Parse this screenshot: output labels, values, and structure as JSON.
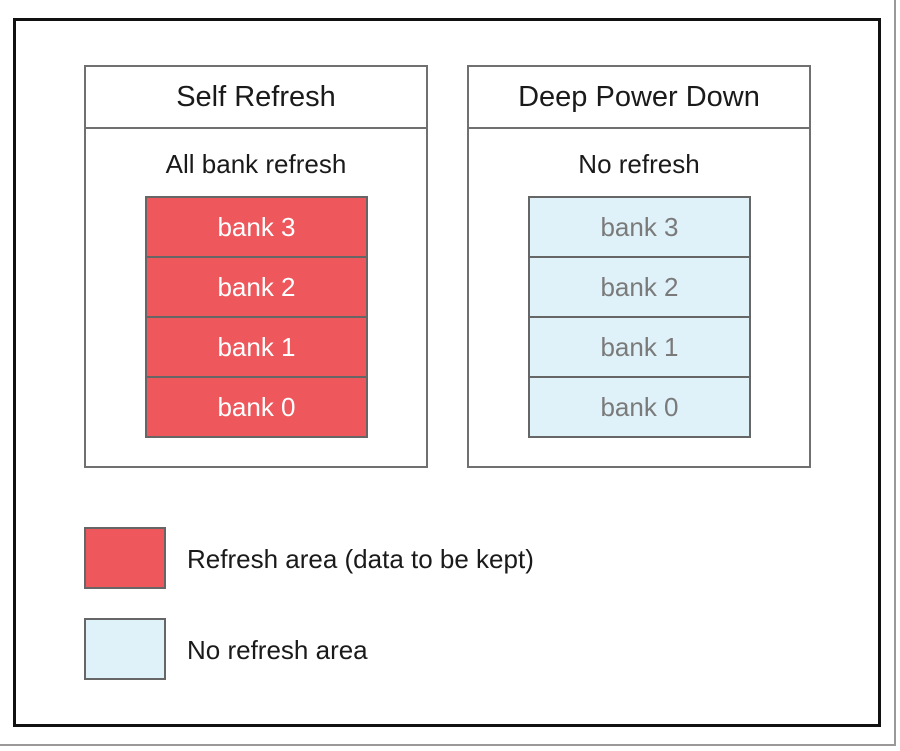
{
  "colors": {
    "refresh": "#ee575c",
    "no_refresh": "#dff1f9"
  },
  "panels": [
    {
      "title": "Self Refresh",
      "subtitle": "All bank refresh",
      "banks": [
        "bank 3",
        "bank 2",
        "bank 1",
        "bank 0"
      ]
    },
    {
      "title": "Deep Power Down",
      "subtitle": "No refresh",
      "banks": [
        "bank 3",
        "bank 2",
        "bank 1",
        "bank 0"
      ]
    }
  ],
  "legend": [
    {
      "label": "Refresh area (data to be kept)"
    },
    {
      "label": "No refresh area"
    }
  ]
}
